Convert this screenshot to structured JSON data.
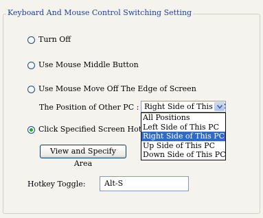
{
  "group": {
    "title": "Keyboard And Mouse Control Switching Setting"
  },
  "options": {
    "turn_off": "Turn Off",
    "middle_button": "Use Mouse Middle Button",
    "move_off_edge": "Use Mouse Move Off The Edge of Screen",
    "hot_area": "Click Specified Screen Hot Area",
    "selected": "hot_area"
  },
  "position": {
    "label": "The Position of Other PC :",
    "value": "Right Side of This PC",
    "options": [
      "All Positions",
      "Left Side of This PC",
      "Right Side of This PC",
      "Up Side of This PC",
      "Down Side of This PC"
    ],
    "highlighted": "Right Side of This PC"
  },
  "view_button": {
    "label": "View and Specify Area"
  },
  "hotkey": {
    "label": "Hotkey Toggle:",
    "value": "Alt-S"
  }
}
